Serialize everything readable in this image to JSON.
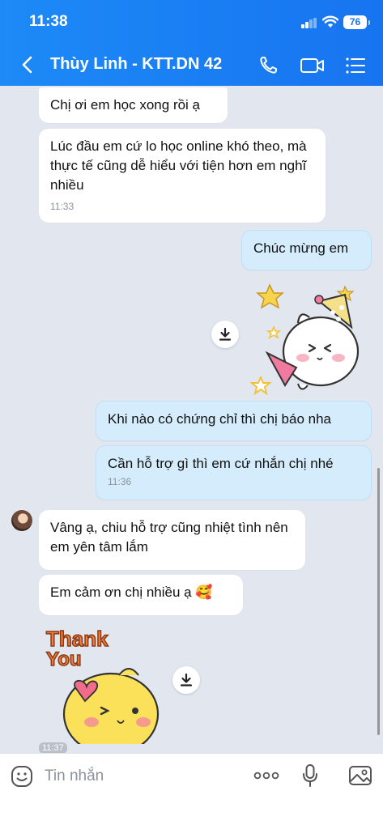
{
  "status": {
    "time": "11:38",
    "battery": "76"
  },
  "header": {
    "title": "Thùy Linh - KTT.DN 42"
  },
  "messages": [
    {
      "text": "Chị ơi em học xong rồi ạ"
    },
    {
      "text": "Lúc đầu em cứ lo học online khó theo, mà thực tế cũng dễ hiểu với tiện hơn em nghĩ nhiều",
      "time": "11:33"
    },
    {
      "text": "Chúc mừng em"
    },
    {
      "text": "Khi nào có chứng chỉ thì chị báo nha"
    },
    {
      "text": "Cần hỗ trợ gì thì em cứ nhắn chị nhé",
      "time": "11:36"
    },
    {
      "text": "Vâng ạ, chiu hỗ trợ cũng nhiệt tình nên em yên tâm lắm"
    },
    {
      "text": "Em cảm ơn chị nhiều ạ 🥰"
    }
  ],
  "stickers": {
    "thank_you_line1": "Thank",
    "thank_you_line2": "You"
  },
  "partial_time": "11:37",
  "input": {
    "placeholder": "Tin nhắn"
  },
  "colors": {
    "header": "#1774f0",
    "my_bubble": "#d4ecfb",
    "their_bubble": "#ffffff",
    "chat_bg": "#e2e7ef"
  },
  "icons": [
    "back-icon",
    "phone-icon",
    "video-icon",
    "menu-icon",
    "download-icon",
    "emoji-icon",
    "more-icon",
    "mic-icon",
    "image-icon"
  ]
}
